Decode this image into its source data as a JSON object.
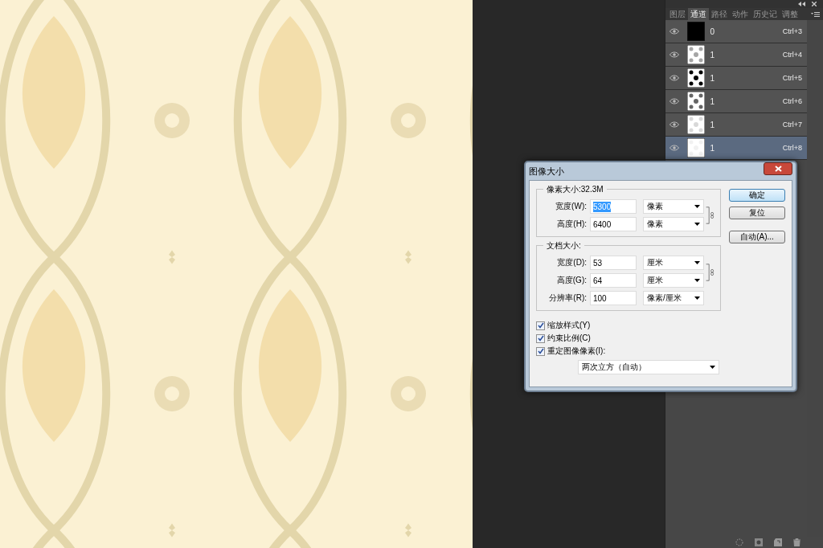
{
  "panel": {
    "tabs": [
      {
        "label": "图层",
        "selected": false
      },
      {
        "label": "通道",
        "selected": true
      },
      {
        "label": "路径",
        "selected": false
      },
      {
        "label": "动作",
        "selected": false
      },
      {
        "label": "历史记",
        "selected": false
      },
      {
        "label": "调整",
        "selected": false
      }
    ],
    "channels": [
      {
        "name": "0",
        "shortcut": "Ctrl+3",
        "kind": "solid",
        "selected": false
      },
      {
        "name": "1",
        "shortcut": "Ctrl+4",
        "kind": "light",
        "selected": false
      },
      {
        "name": "1",
        "shortcut": "Ctrl+5",
        "kind": "dark",
        "selected": false
      },
      {
        "name": "1",
        "shortcut": "Ctrl+6",
        "kind": "dots",
        "selected": false
      },
      {
        "name": "1",
        "shortcut": "Ctrl+7",
        "kind": "faint",
        "selected": false
      },
      {
        "name": "1",
        "shortcut": "Ctrl+8",
        "kind": "blank",
        "selected": true
      }
    ]
  },
  "dialog": {
    "title": "图像大小",
    "pixel_group": {
      "legend": "像素大小:32.3M",
      "fields": [
        {
          "label": "宽度(W):",
          "value": "5300",
          "unit": "像素",
          "selected": true
        },
        {
          "label": "高度(H):",
          "value": "6400",
          "unit": "像素",
          "selected": false
        }
      ]
    },
    "document_group": {
      "legend": "文档大小:",
      "fields": [
        {
          "label": "宽度(D):",
          "value": "53",
          "unit": "厘米",
          "selected": false
        },
        {
          "label": "高度(G):",
          "value": "64",
          "unit": "厘米",
          "selected": false
        },
        {
          "label": "分辨率(R):",
          "value": "100",
          "unit": "像素/厘米",
          "selected": false
        }
      ]
    },
    "checkboxes": [
      {
        "label": "缩放样式(Y)",
        "checked": true
      },
      {
        "label": "约束比例(C)",
        "checked": true
      },
      {
        "label": "重定图像像素(I):",
        "checked": true
      }
    ],
    "resample": "两次立方（自动）",
    "buttons": [
      {
        "label": "确定",
        "default": true
      },
      {
        "label": "复位",
        "default": false
      },
      {
        "label": "自动(A)...",
        "default": false
      }
    ]
  }
}
